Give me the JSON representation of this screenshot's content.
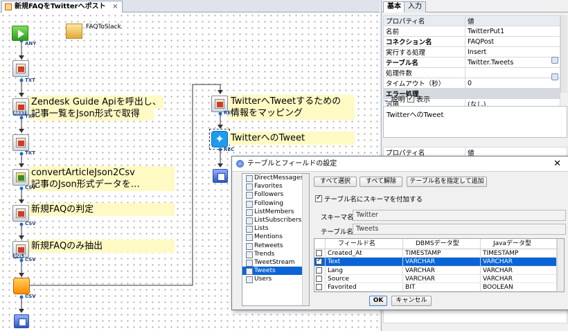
{
  "editor": {
    "tab_title": "新規FAQをTwitterへポスト",
    "tab_close": "×"
  },
  "canvas": {
    "hint_label": "FAQToSlack",
    "ports": [
      "ANY",
      "TXT",
      "TXT",
      "CSV",
      "CSV",
      "CSV",
      "CSV",
      "REC",
      "REC"
    ],
    "labels": {
      "zendesk_1": "Zendesk Guide Apiを呼出し、",
      "zendesk_2": "記事一覧をJson形式で取得",
      "convert_1": "convertArticleJson2Csv",
      "convert_2": "記事のJson形式データを…",
      "judge": "新規FAQの判定",
      "extract": "新規FAQのみ抽出",
      "mapping_1": "TwitterへTweetするための",
      "mapping_2": "情報をマッピング",
      "tweet": "TwitterへのTweet"
    }
  },
  "right_panel": {
    "tabs": [
      "基本",
      "入力"
    ],
    "header": {
      "key": "プロパティ名",
      "value": "値"
    },
    "properties": [
      {
        "key": "名前",
        "value": "TwitterPut1",
        "bold": false
      },
      {
        "key": "コネクション名",
        "value": "FAQPost",
        "bold": true
      },
      {
        "key": "実行する処理",
        "value": "Insert",
        "bold": false
      },
      {
        "key": "テーブル名",
        "value": "Twitter.Tweets",
        "bold": true
      },
      {
        "key": "処理件数",
        "value": "",
        "bold": false
      },
      {
        "key": "タイムアウト（秒）",
        "value": "0",
        "bold": false
      },
      {
        "key": "エラー処理",
        "value": "",
        "category": true
      },
      {
        "key": "汎用",
        "value": "(なし)",
        "bold": false
      }
    ],
    "description_tab": "説明",
    "show_label": "表示",
    "description_text": "TwitterへのTweet",
    "header2": {
      "key": "プロパティ名",
      "value": "値"
    }
  },
  "dialog": {
    "title": "テーブルとフィールドの設定",
    "close": "✕",
    "tables": [
      "DirectMessages",
      "Favorites",
      "Followers",
      "Following",
      "ListMembers",
      "ListSubscribers",
      "Lists",
      "Mentions",
      "Retweets",
      "Trends",
      "TweetStream",
      "Tweets",
      "Users"
    ],
    "selected_table": "Tweets",
    "select_all": "すべて選択",
    "deselect_all": "すべて解除",
    "add_by_name": "テーブル名を指定して追加",
    "schema_checkbox": "テーブル名にスキーマを付加する",
    "schema_label": "スキーマ名",
    "schema_value": "Twitter",
    "table_label": "テーブル名",
    "table_value": "Tweets",
    "columns": [
      "フィールド名",
      "DBMSデータ型",
      "Javaデータ型"
    ],
    "fields": [
      {
        "name": "Created_At",
        "dbms": "TIMESTAMP",
        "java": "TIMESTAMP",
        "checked": false
      },
      {
        "name": "Text",
        "dbms": "VARCHAR",
        "java": "VARCHAR",
        "checked": true
      },
      {
        "name": "Lang",
        "dbms": "VARCHAR",
        "java": "VARCHAR",
        "checked": false
      },
      {
        "name": "Source",
        "dbms": "VARCHAR",
        "java": "VARCHAR",
        "checked": false
      },
      {
        "name": "Favorited",
        "dbms": "BIT",
        "java": "BOOLEAN",
        "checked": false
      }
    ],
    "selected_field": "Text",
    "ok": "OK",
    "cancel": "キャンセル"
  }
}
